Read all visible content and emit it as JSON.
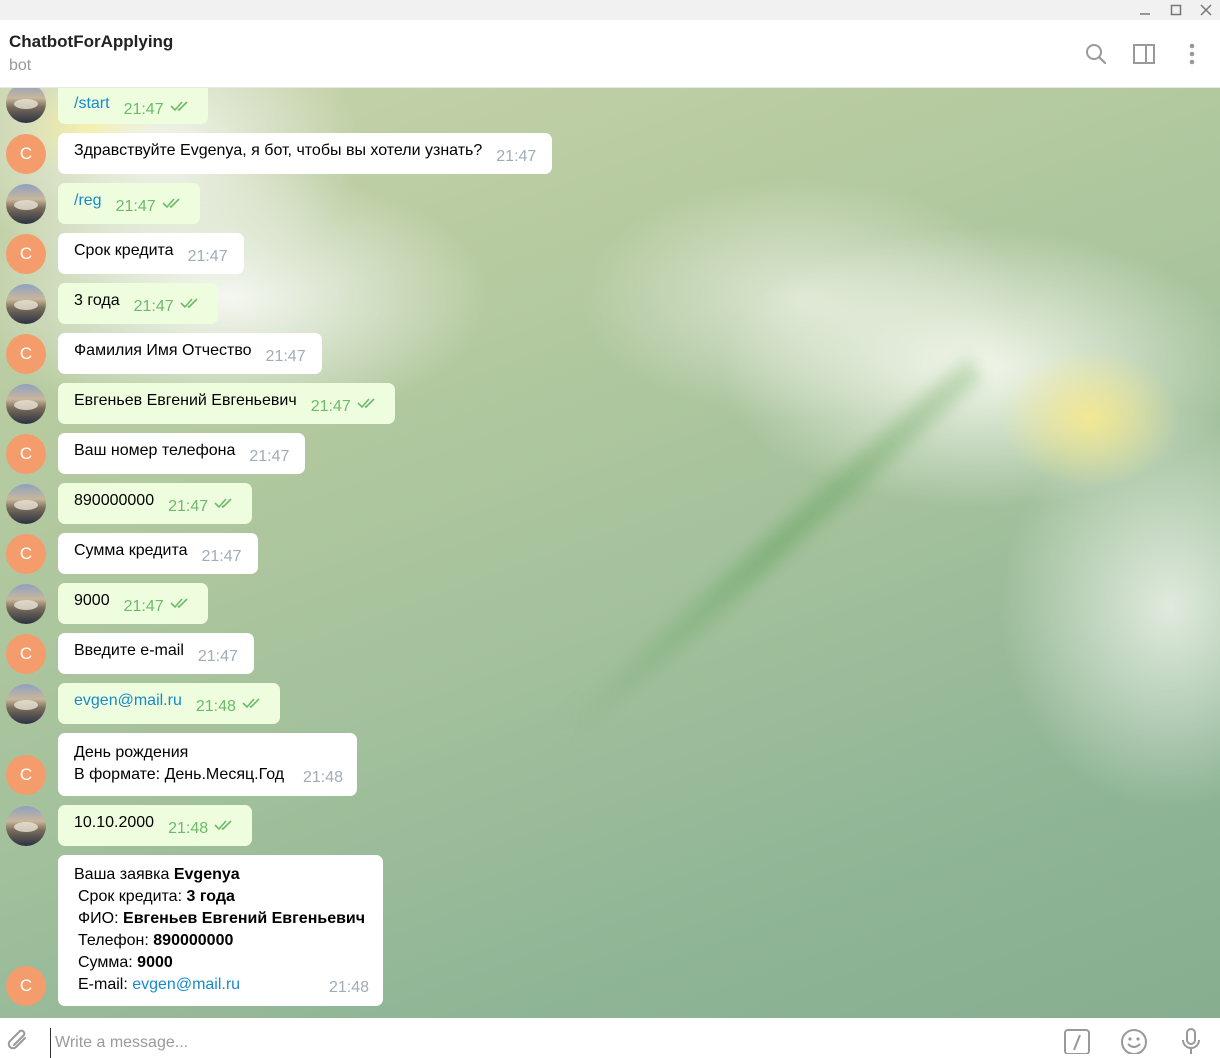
{
  "window": {
    "controls": [
      "minimize-icon",
      "maximize-icon",
      "close-icon"
    ]
  },
  "header": {
    "title": "ChatbotForApplying",
    "status": "bot",
    "icons": [
      "search-icon",
      "sidebar-toggle-icon",
      "more-vertical-icon"
    ]
  },
  "chat": {
    "bot_avatar_letter": "C",
    "messages": [
      {
        "from": "user",
        "text": "/start",
        "time": "21:47",
        "is_command": true
      },
      {
        "from": "bot",
        "text": "Здравствуйте Evgenya, я бот, чтобы вы хотели узнать?",
        "time": "21:47"
      },
      {
        "from": "user",
        "text": "/reg",
        "time": "21:47",
        "is_command": true
      },
      {
        "from": "bot",
        "text": "Срок кредита",
        "time": "21:47"
      },
      {
        "from": "user",
        "text": "3 года",
        "time": "21:47"
      },
      {
        "from": "bot",
        "text": "Фамилия Имя Отчество",
        "time": "21:47"
      },
      {
        "from": "user",
        "text": "Евгеньев Евгений Евгеньевич",
        "time": "21:47"
      },
      {
        "from": "bot",
        "text": "Ваш номер телефона",
        "time": "21:47"
      },
      {
        "from": "user",
        "text": "890000000",
        "time": "21:47"
      },
      {
        "from": "bot",
        "text": "Сумма кредита",
        "time": "21:47"
      },
      {
        "from": "user",
        "text": "9000",
        "time": "21:47"
      },
      {
        "from": "bot",
        "text": "Введите e-mail",
        "time": "21:47"
      },
      {
        "from": "user",
        "text": "evgen@mail.ru",
        "time": "21:48",
        "is_link": true
      },
      {
        "from": "bot",
        "lines": [
          "День рождения",
          "В формате: День.Месяц.Год"
        ],
        "time": "21:48"
      },
      {
        "from": "user",
        "text": "10.10.2000",
        "time": "21:48"
      },
      {
        "from": "bot",
        "time": "21:48",
        "summary": {
          "intro_label": "Ваша заявка",
          "intro_value": "Evgenya",
          "term_label": "Срок кредита:",
          "term_value": "3 года",
          "name_label": "ФИО:",
          "name_value": "Евгеньев Евгений Евгеньевич",
          "phone_label": "Телефон:",
          "phone_value": "890000000",
          "amount_label": "Сумма:",
          "amount_value": "9000",
          "email_label": "E-mail:",
          "email_value": "evgen@mail.ru"
        }
      }
    ]
  },
  "input": {
    "placeholder": "Write a message...",
    "icons": [
      "attach-icon",
      "commands-icon",
      "emoji-icon",
      "microphone-icon"
    ]
  },
  "colors": {
    "outgoing_bubble": "#effddf",
    "incoming_bubble": "#ffffff",
    "link": "#168acd",
    "read_checks": "#6cba6b",
    "bot_avatar": "#f49c6b"
  }
}
